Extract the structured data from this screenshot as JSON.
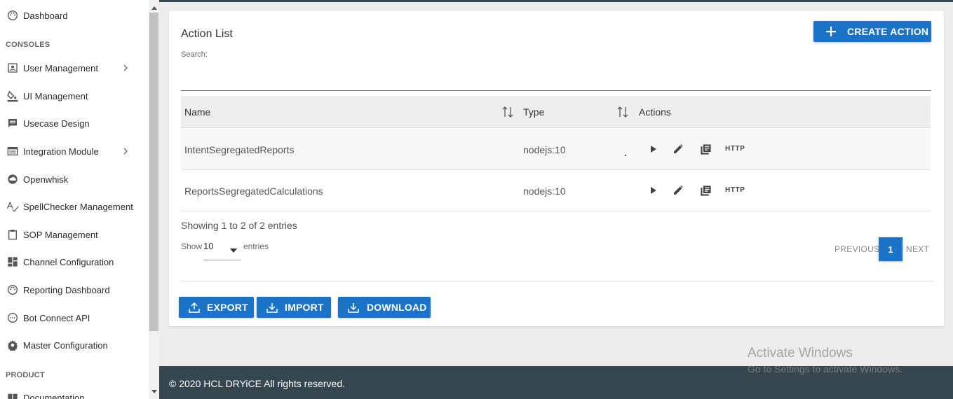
{
  "sidebar": {
    "items": [
      {
        "label": "Dashboard",
        "icon": "palette-icon"
      },
      {
        "label": "User Management",
        "icon": "account-box-icon"
      },
      {
        "label": "UI Management",
        "icon": "paint-bucket-icon"
      },
      {
        "label": "Usecase Design",
        "icon": "message-box-icon"
      },
      {
        "label": "Integration Module",
        "icon": "window-icon"
      },
      {
        "label": "Openwhisk",
        "icon": "cloud-icon"
      },
      {
        "label": "SpellChecker Management",
        "icon": "spellcheck-icon"
      },
      {
        "label": "SOP Management",
        "icon": "clipboard-icon"
      },
      {
        "label": "Channel Configuration",
        "icon": "dashboard-tiles-icon"
      },
      {
        "label": "Reporting Dashboard",
        "icon": "palette-icon"
      },
      {
        "label": "Bot Connect API",
        "icon": "api-icon"
      },
      {
        "label": "Master Configuration",
        "icon": "gear-icon"
      },
      {
        "label": "Documentation",
        "icon": "book-icon"
      }
    ],
    "sections": {
      "consoles": "CONSOLES",
      "product": "PRODUCT"
    }
  },
  "main": {
    "title": "Action List",
    "search_label": "Search:",
    "create_button": "CREATE ACTION",
    "table": {
      "columns": [
        "Name",
        "Type",
        "Actions"
      ],
      "rows": [
        {
          "name": "IntentSegregatedReports",
          "type": "nodejs:10",
          "http": "HTTP"
        },
        {
          "name": "ReportsSegregatedCalculations",
          "type": "nodejs:10",
          "http": "HTTP"
        }
      ]
    },
    "info": "Showing 1 to 2 of 2 entries",
    "show_label": "Show",
    "show_value": "10",
    "entries_label": "entries",
    "pagination": {
      "previous": "PREVIOUS",
      "current": "1",
      "next": "NEXT"
    },
    "buttons": {
      "export": "EXPORT",
      "import": "IMPORT",
      "download": "DOWNLOAD"
    }
  },
  "footer": {
    "text": "© 2020 HCL DRYiCE All rights reserved."
  },
  "watermark": {
    "line1": "Activate Windows",
    "line2": "Go to Settings to activate Windows."
  },
  "colors": {
    "primary": "#1a73c6",
    "footer": "#37474f"
  }
}
